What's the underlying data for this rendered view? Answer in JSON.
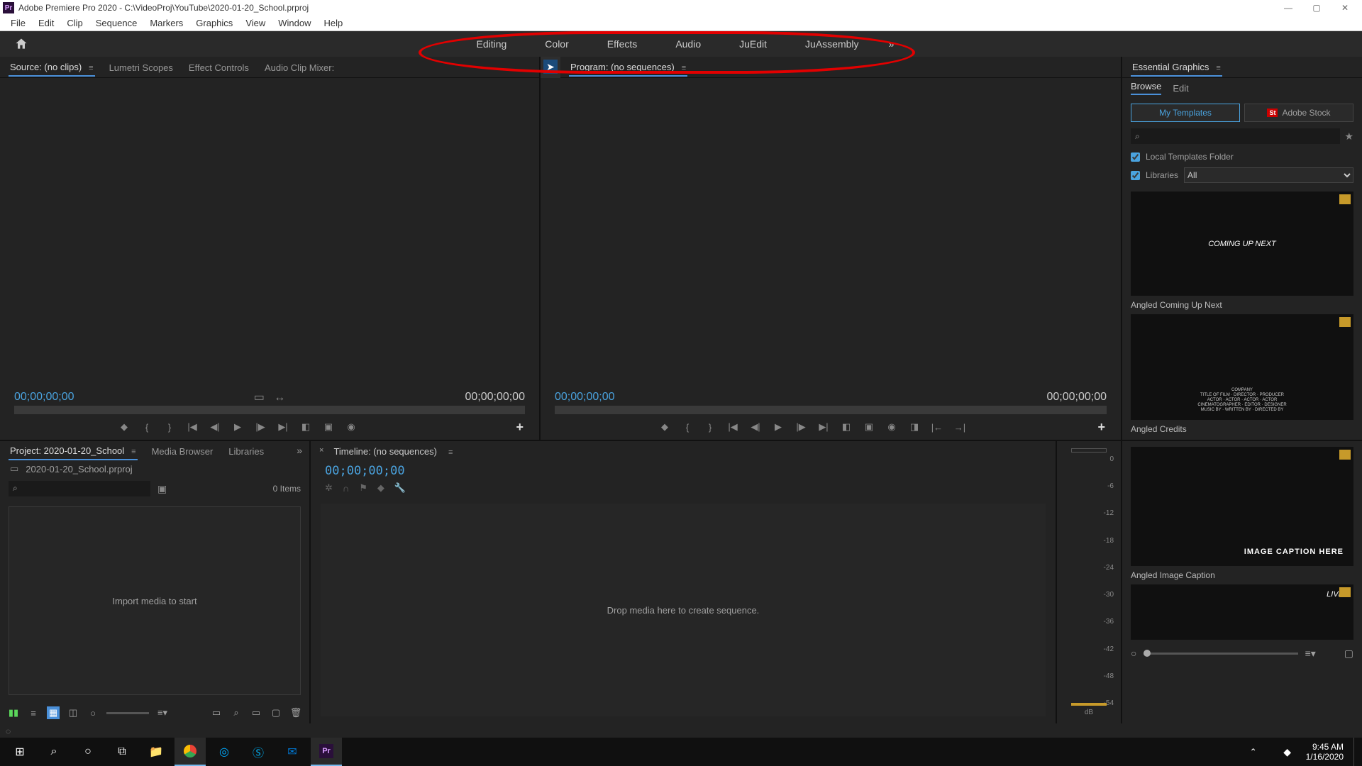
{
  "titlebar": {
    "app": "Adobe Premiere Pro 2020",
    "path": "C:\\VideoProj\\YouTube\\2020-01-20_School.prproj"
  },
  "menu": [
    "File",
    "Edit",
    "Clip",
    "Sequence",
    "Markers",
    "Graphics",
    "View",
    "Window",
    "Help"
  ],
  "workspaces": [
    "Editing",
    "Color",
    "Effects",
    "Audio",
    "JuEdit",
    "JuAssembly"
  ],
  "source_tabs": {
    "source": "Source: (no clips)",
    "lumetri": "Lumetri Scopes",
    "effect": "Effect Controls",
    "audio": "Audio Clip Mixer:"
  },
  "program_tab": "Program: (no sequences)",
  "timecode": {
    "zero": "00;00;00;00"
  },
  "essential": {
    "title": "Essential Graphics",
    "tab_browse": "Browse",
    "tab_edit": "Edit",
    "pill_my": "My Templates",
    "pill_stock": "Adobe Stock",
    "chk_local": "Local Templates Folder",
    "chk_lib": "Libraries",
    "lib_sel": "All",
    "tmpl1": "Angled Coming Up Next",
    "tmpl1_text": "COMING UP NEXT",
    "tmpl2": "Angled Credits",
    "tmpl3": "Angled Image Caption",
    "tmpl3_text": "IMAGE CAPTION HERE",
    "tmpl4": "LIVE"
  },
  "project": {
    "tab_proj": "Project: 2020-01-20_School",
    "tab_media": "Media Browser",
    "tab_lib": "Libraries",
    "file": "2020-01-20_School.prproj",
    "items": "0 Items",
    "drop": "Import media to start"
  },
  "timeline": {
    "tab": "Timeline: (no sequences)",
    "drop": "Drop media here to create sequence."
  },
  "meter": {
    "labels": [
      "0",
      "-6",
      "-12",
      "-18",
      "-24",
      "-30",
      "-36",
      "-42",
      "-48",
      "-54"
    ],
    "db": "dB"
  },
  "clock": {
    "time": "9:45 AM",
    "date": "1/16/2020"
  }
}
